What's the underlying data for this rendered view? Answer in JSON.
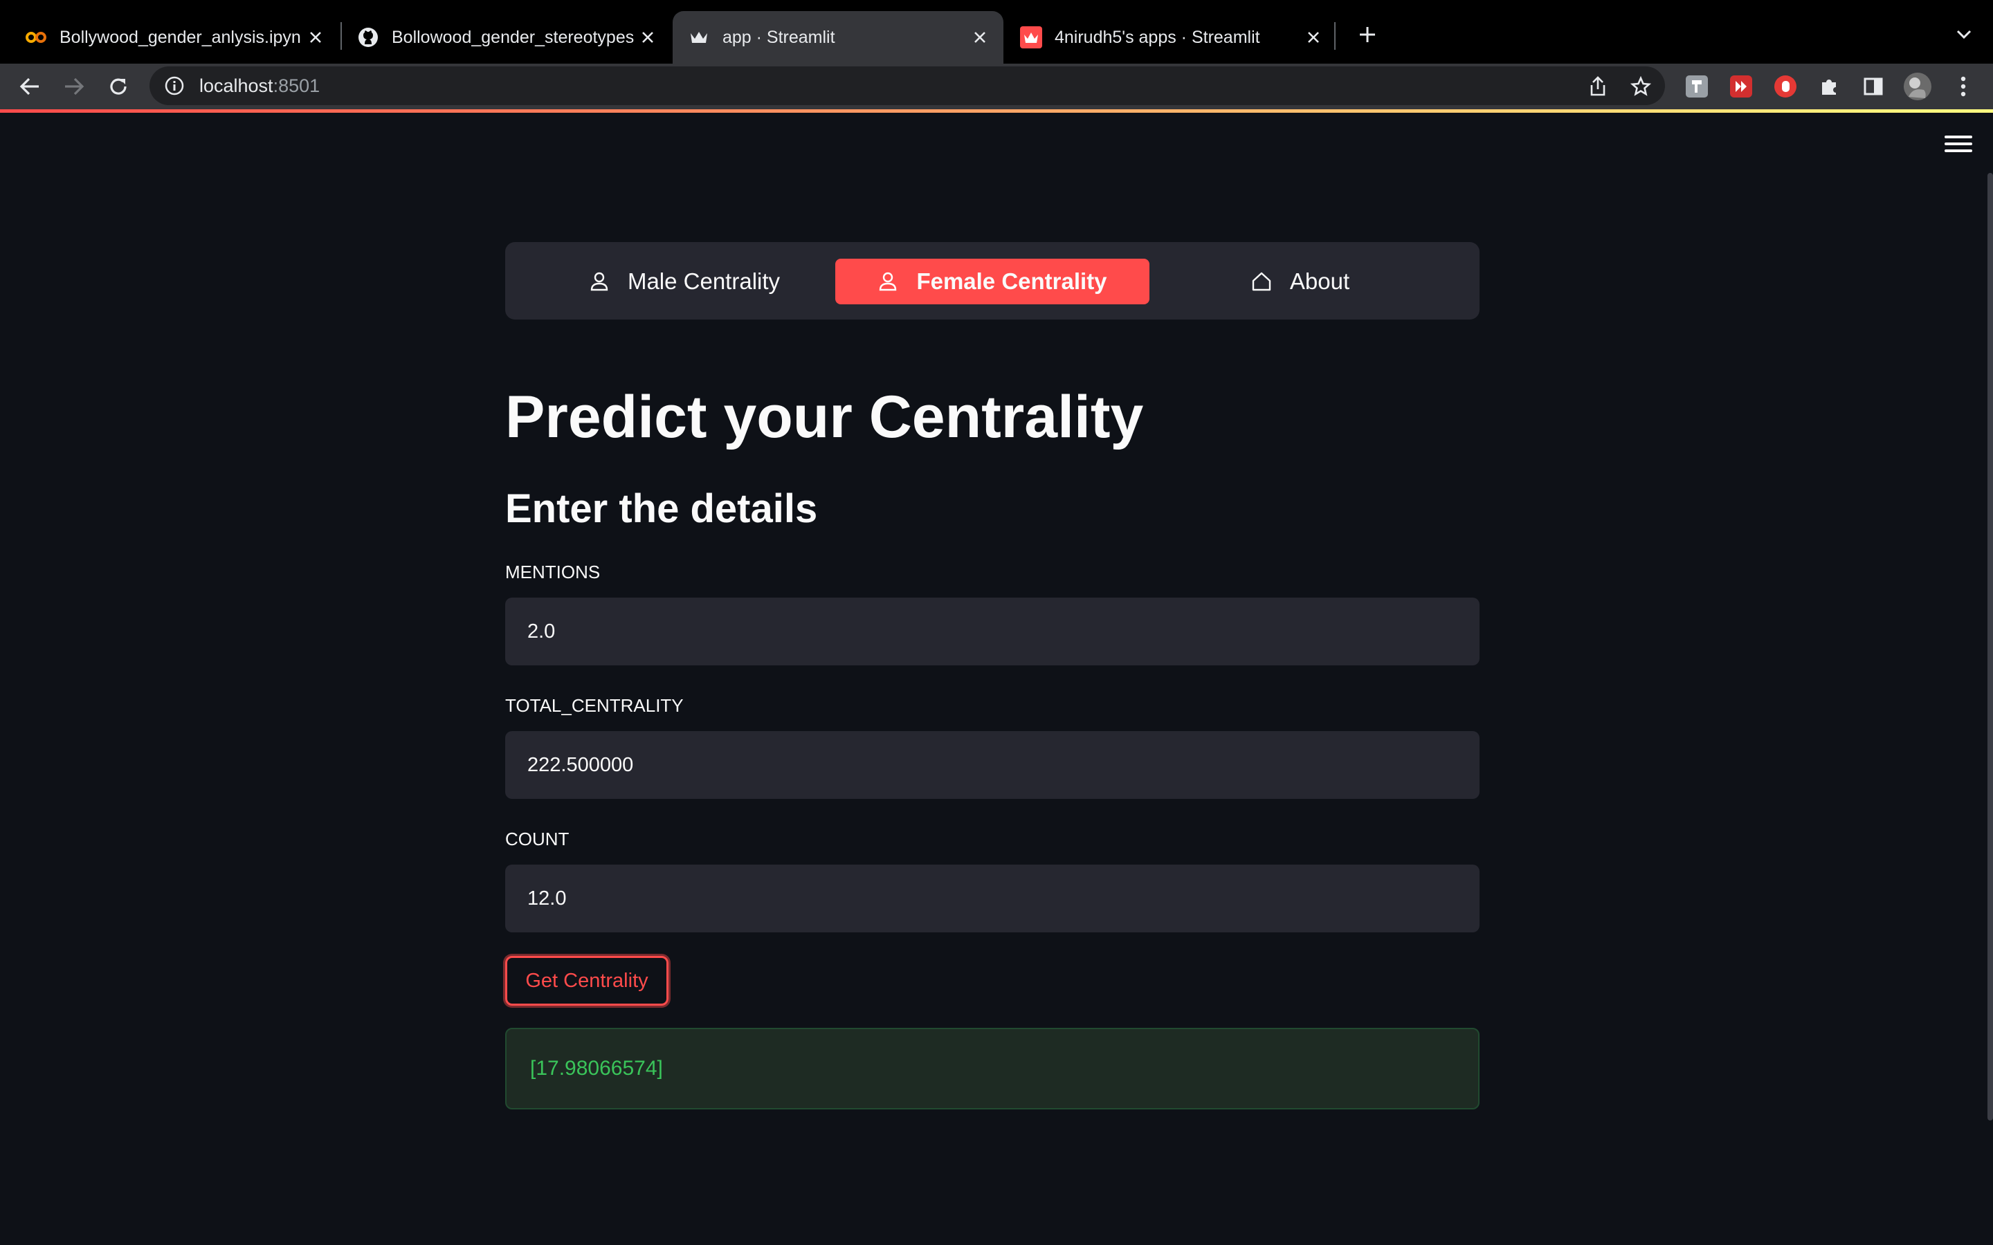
{
  "browser": {
    "tabs": [
      {
        "title": "Bollywood_gender_anlysis.ipynb",
        "favicon": "colab-icon",
        "active": false
      },
      {
        "title": "Bollowood_gender_stereotypes",
        "favicon": "github-icon",
        "active": false
      },
      {
        "title": "app · Streamlit",
        "favicon": "streamlit-crown-icon",
        "active": true
      },
      {
        "title": "4nirudh5's apps · Streamlit",
        "favicon": "streamlit-icon",
        "active": false
      }
    ],
    "address": {
      "host": "localhost",
      "port": ":8501"
    }
  },
  "app": {
    "nav": {
      "items": [
        {
          "label": "Male Centrality",
          "icon": "person-icon",
          "selected": false
        },
        {
          "label": "Female Centrality",
          "icon": "person-icon",
          "selected": true
        },
        {
          "label": "About",
          "icon": "house-icon",
          "selected": false
        }
      ]
    },
    "title": "Predict your Centrality",
    "subtitle": "Enter the details",
    "fields": [
      {
        "label": "MENTIONS",
        "value": "2.0"
      },
      {
        "label": "TOTAL_CENTRALITY",
        "value": "222.500000"
      },
      {
        "label": "COUNT",
        "value": "12.0"
      }
    ],
    "button_label": "Get Centrality",
    "result": "[17.98066574]",
    "colors": {
      "accent": "#ff4b4b",
      "background": "#0e1117",
      "success_text": "#3ac45a"
    }
  }
}
